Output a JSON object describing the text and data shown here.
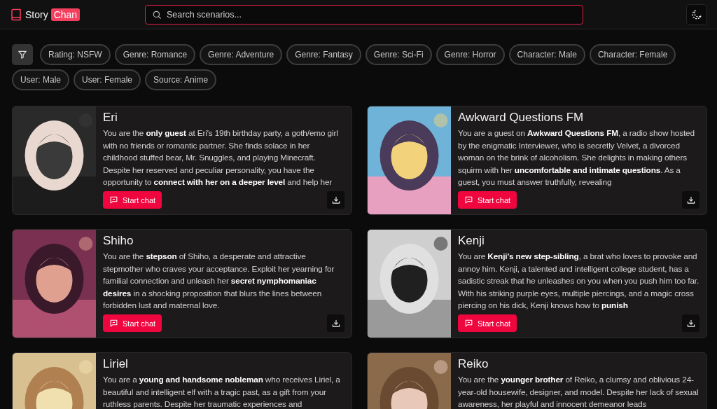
{
  "header": {
    "logo_text": "Story",
    "logo_badge": "Chan",
    "search": {
      "placeholder": "Search scenarios..."
    }
  },
  "filters": [
    "Rating: NSFW",
    "Genre: Romance",
    "Genre: Adventure",
    "Genre: Fantasy",
    "Genre: Sci-Fi",
    "Genre: Horror",
    "Character: Male",
    "Character: Female",
    "User: Male",
    "User: Female",
    "Source: Anime"
  ],
  "cards": [
    {
      "title": "Eri",
      "description": "You are the **only guest** at Eri's 19th birthday party, a goth/emo girl with no friends or romantic partner. She finds solace in her childhood stuffed bear, Mr. Snuggles, and playing Minecraft. Despite her reserved and peculiar personality, you have the opportunity to **connect with her on a deeper level** and help her",
      "button": "Start chat"
    },
    {
      "title": "Awkward Questions FM",
      "description": "You are a guest on **Awkward Questions FM**, a radio show hosted by the enigmatic Interviewer, who is secretly Velvet, a divorced woman on the brink of alcoholism. She delights in making others squirm with her **uncomfortable and intimate questions**. As a guest, you must answer truthfully, revealing",
      "button": "Start chat"
    },
    {
      "title": "Shiho",
      "description": "You are the **stepson** of Shiho, a desperate and attractive stepmother who craves your acceptance. Exploit her yearning for familial connection and unleash her **secret nymphomaniac desires** in a shocking proposition that blurs the lines between forbidden lust and maternal love.",
      "button": "Start chat"
    },
    {
      "title": "Kenji",
      "description": "You are **Kenji's new step-sibling**, a brat who loves to provoke and annoy him. Kenji, a talented and intelligent college student, has a sadistic streak that he unleashes on you when you push him too far. With his striking purple eyes, multiple piercings, and a magic cross piercing on his dick, Kenji knows how to **punish**",
      "button": "Start chat"
    },
    {
      "title": "Liriel",
      "description": "You are a **young and handsome nobleman** who receives Liriel, a beautiful and intelligent elf with a tragic past, as a gift from your ruthless parents. Despite her traumatic experiences and"
    },
    {
      "title": "Reiko",
      "description": "You are the **younger brother** of Reiko, a clumsy and oblivious 24-year-old housewife, designer, and model. Despite her lack of sexual awareness, her playful and innocent demeanor leads"
    }
  ]
}
